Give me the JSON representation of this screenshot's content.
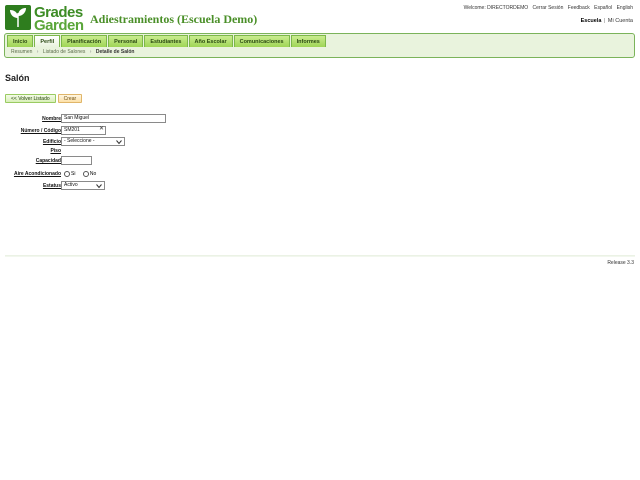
{
  "logo": {
    "line1": "Grades",
    "line2": "Garden"
  },
  "app_title": "Adiestramientos (Escuela Demo)",
  "top_links": {
    "welcome": "Welcome: DIRECTORDEMO",
    "logout": "Cerrar Sesión",
    "feedback": "Feedback",
    "lang_es": "Español",
    "lang_en": "English"
  },
  "scope": {
    "school": "Escuela",
    "separator": "|",
    "mine": "Mi Cuenta"
  },
  "nav": {
    "tabs": [
      {
        "label": "Inicio",
        "active": false
      },
      {
        "label": "Perfil",
        "active": true
      },
      {
        "label": "Planificación",
        "active": false
      },
      {
        "label": "Personal",
        "active": false
      },
      {
        "label": "Estudiantes",
        "active": false
      },
      {
        "label": "Año Escolar",
        "active": false
      },
      {
        "label": "Comunicaciones",
        "active": false
      },
      {
        "label": "Informes",
        "active": false
      }
    ],
    "breadcrumbs": [
      "Resumen",
      "Listado de Salones",
      "Detalle de Salón"
    ]
  },
  "page": {
    "title": "Salón",
    "back_button": "<< Volver Listado",
    "create_button": "Crear"
  },
  "form": {
    "nombre": {
      "label": "Nombre",
      "value": "San Miguel"
    },
    "numero": {
      "label": "Número / Código",
      "value": "SM201"
    },
    "edificio": {
      "label": "Edificio",
      "value": "- Seleccione -"
    },
    "piso": {
      "label": "Piso"
    },
    "capacidad": {
      "label": "Capacidad",
      "value": ""
    },
    "aire": {
      "label": "Aire Acondicionado",
      "options": [
        "Si",
        "No"
      ]
    },
    "estatus": {
      "label": "Estatus",
      "value": "Activo"
    }
  },
  "footer": {
    "release": "Release 3.3"
  },
  "colors": {
    "brand_green": "#3d8c25",
    "nav_green": "#9fd556"
  }
}
